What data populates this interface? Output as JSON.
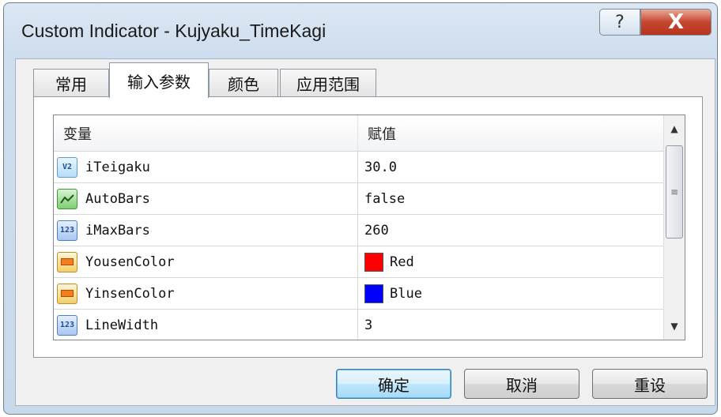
{
  "window": {
    "title": "Custom Indicator - Kujyaku_TimeKagi",
    "help_label": "?",
    "close_label": "X"
  },
  "tabs": [
    {
      "label": "常用",
      "active": false
    },
    {
      "label": "输入参数",
      "active": true
    },
    {
      "label": "颜色",
      "active": false
    },
    {
      "label": "应用范围",
      "active": false
    }
  ],
  "grid": {
    "columns": {
      "name": "变量",
      "value": "赋值"
    },
    "rows": [
      {
        "icon": "double-type-icon",
        "icon_text": "V2",
        "name": "iTeigaku",
        "value": "30.0"
      },
      {
        "icon": "bool-type-icon",
        "icon_text": "",
        "name": "AutoBars",
        "value": "false"
      },
      {
        "icon": "int-type-icon",
        "icon_text": "123",
        "name": "iMaxBars",
        "value": "260"
      },
      {
        "icon": "color-type-icon",
        "icon_text": "",
        "name": "YousenColor",
        "value": "Red",
        "swatch": "#ff0000"
      },
      {
        "icon": "color-type-icon",
        "icon_text": "",
        "name": "YinsenColor",
        "value": "Blue",
        "swatch": "#0000ff"
      },
      {
        "icon": "int-type-icon",
        "icon_text": "123",
        "name": "LineWidth",
        "value": "3"
      }
    ]
  },
  "buttons": {
    "ok": "确定",
    "cancel": "取消",
    "reset": "重设"
  }
}
